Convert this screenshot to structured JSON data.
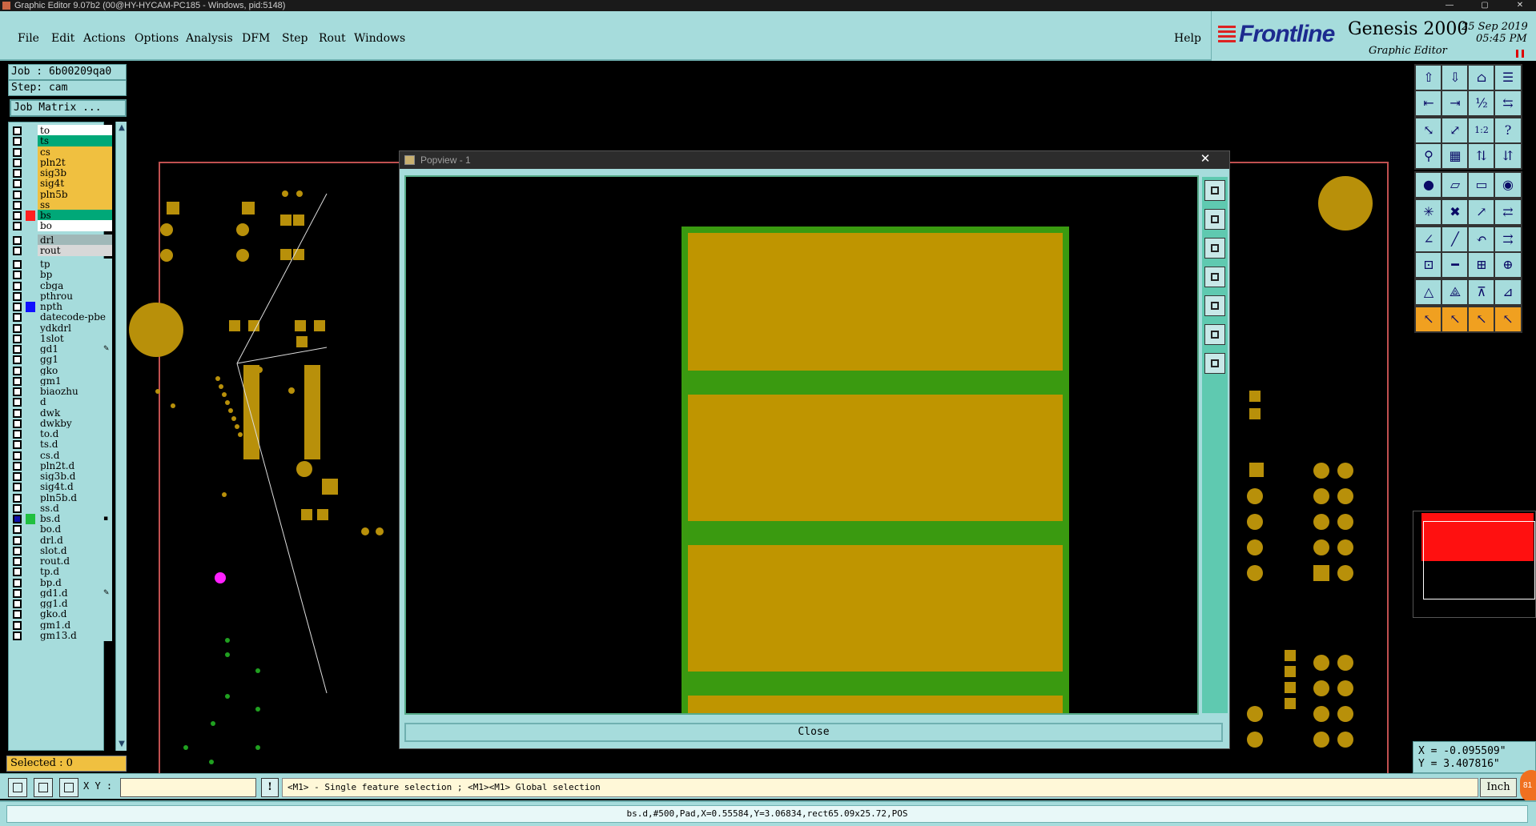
{
  "window": {
    "title": "Graphic Editor 9.07b2 (00@HY-HYCAM-PC185 - Windows, pid:5148)",
    "controls": [
      "—",
      "▢",
      "✕"
    ]
  },
  "menu": {
    "items": [
      "File",
      "Edit",
      "Actions",
      "Options",
      "Analysis",
      "DFM",
      "Step",
      "Rout",
      "Windows"
    ],
    "help": "Help"
  },
  "brand": {
    "logo": "Frontline",
    "product": "Genesis 2000",
    "subtitle": "Graphic Editor",
    "date": "25 Sep 2019",
    "time": "05:45 PM"
  },
  "job": {
    "job_label": "Job : 6b00209qa0",
    "step_label": "Step: cam",
    "matrix_button": "Job Matrix ..."
  },
  "layers": [
    {
      "name": "to",
      "color": "#ffffff"
    },
    {
      "name": "ts",
      "color": "#00a878"
    },
    {
      "name": "cs",
      "color": "#f0c040"
    },
    {
      "name": "pln2t",
      "color": "#f0c040"
    },
    {
      "name": "sig3b",
      "color": "#f0c040"
    },
    {
      "name": "sig4t",
      "color": "#f0c040"
    },
    {
      "name": "pln5b",
      "color": "#f0c040"
    },
    {
      "name": "ss",
      "color": "#f0c040"
    },
    {
      "name": "bs",
      "color": "#00a878",
      "swatch": "#ff2020"
    },
    {
      "name": "bo",
      "color": "#ffffff"
    },
    {
      "name": "drl",
      "color": "#a0b8b8"
    },
    {
      "name": "rout",
      "color": "#d8d8d8"
    },
    {
      "name": "tp"
    },
    {
      "name": "bp"
    },
    {
      "name": "cbga"
    },
    {
      "name": "pthrou"
    },
    {
      "name": "npth",
      "swatch": "#1010ff"
    },
    {
      "name": "datecode-pbe"
    },
    {
      "name": "ydkdrl"
    },
    {
      "name": "1slot"
    },
    {
      "name": "gd1",
      "mark": "✎"
    },
    {
      "name": "gg1"
    },
    {
      "name": "gko"
    },
    {
      "name": "gm1"
    },
    {
      "name": "biaozhu"
    },
    {
      "name": "d"
    },
    {
      "name": "dwk"
    },
    {
      "name": "dwkby"
    },
    {
      "name": "to.d"
    },
    {
      "name": "ts.d"
    },
    {
      "name": "cs.d"
    },
    {
      "name": "pln2t.d"
    },
    {
      "name": "sig3b.d"
    },
    {
      "name": "sig4t.d"
    },
    {
      "name": "pln5b.d"
    },
    {
      "name": "ss.d"
    },
    {
      "name": "bs.d",
      "swatch": "#20c040",
      "active": true,
      "mark": "▪"
    },
    {
      "name": "bo.d"
    },
    {
      "name": "drl.d"
    },
    {
      "name": "slot.d"
    },
    {
      "name": "rout.d"
    },
    {
      "name": "tp.d"
    },
    {
      "name": "bp.d"
    },
    {
      "name": "gd1.d",
      "mark": "✎"
    },
    {
      "name": "gg1.d"
    },
    {
      "name": "gko.d"
    },
    {
      "name": "gm1.d"
    },
    {
      "name": "gm13.d"
    }
  ],
  "selected": "Selected : 0",
  "popview": {
    "title": "Popview - 1",
    "close_icon": "✕",
    "close_button": "Close",
    "pad_colors": {
      "frame": "#3a9a10",
      "pad": "#bf9500"
    }
  },
  "coords": {
    "x": "X = -0.095509\"",
    "y": "Y = 3.407816\""
  },
  "command": {
    "xy_label": "X Y :",
    "xy_value": "",
    "bang": "!",
    "hint": "<M1> - Single feature selection ; <M1><M1> Global selection",
    "units": "Inch",
    "badge": "81"
  },
  "status": {
    "text": "bs.d,#500,Pad,X=0.55584,Y=3.06834,rect65.09x25.72,POS"
  },
  "colors": {
    "panel": "#a6dcdc",
    "copper": "#b8900a",
    "board_outline": "#c05050",
    "highlight": "#ff20ff"
  }
}
